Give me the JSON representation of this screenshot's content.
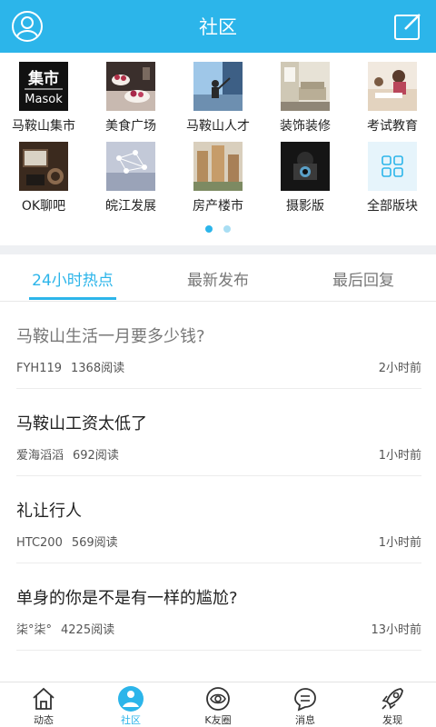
{
  "header": {
    "title": "社区"
  },
  "forums": [
    {
      "label": "马鞍山集市",
      "logo_text_top": "集市",
      "logo_text_bottom": "Masok"
    },
    {
      "label": "美食广场"
    },
    {
      "label": "马鞍山人才"
    },
    {
      "label": "装饰装修"
    },
    {
      "label": "考试教育"
    },
    {
      "label": "OK聊吧"
    },
    {
      "label": "皖江发展"
    },
    {
      "label": "房产楼市"
    },
    {
      "label": "摄影版"
    },
    {
      "label": "全部版块"
    }
  ],
  "pager": {
    "count": 2,
    "active_index": 0
  },
  "tabs": [
    {
      "label": "24小时热点",
      "active": true
    },
    {
      "label": "最新发布",
      "active": false
    },
    {
      "label": "最后回复",
      "active": false
    }
  ],
  "posts": [
    {
      "title": "马鞍山生活一月要多少钱?",
      "author": "FYH119",
      "views": "1368阅读",
      "time": "2小时前",
      "read": true
    },
    {
      "title": "马鞍山工资太低了",
      "author": "爱海滔滔",
      "views": "692阅读",
      "time": "1小时前",
      "read": false
    },
    {
      "title": "礼让行人",
      "author": "HTC200",
      "views": "569阅读",
      "time": "1小时前",
      "read": false
    },
    {
      "title": "单身的你是不是有一样的尴尬?",
      "author": "柒°柒°",
      "views": "4225阅读",
      "time": "13小时前",
      "read": false
    }
  ],
  "bottom_nav": [
    {
      "label": "动态",
      "icon": "home-icon",
      "active": false
    },
    {
      "label": "社区",
      "icon": "community-icon",
      "active": true
    },
    {
      "label": "K友圈",
      "icon": "eye-icon",
      "active": false
    },
    {
      "label": "消息",
      "icon": "message-icon",
      "active": false
    },
    {
      "label": "发现",
      "icon": "rocket-icon",
      "active": false
    }
  ],
  "colors": {
    "accent": "#2cb5ea",
    "divider": "#eef0f3",
    "dot_inactive": "#a9def3"
  }
}
